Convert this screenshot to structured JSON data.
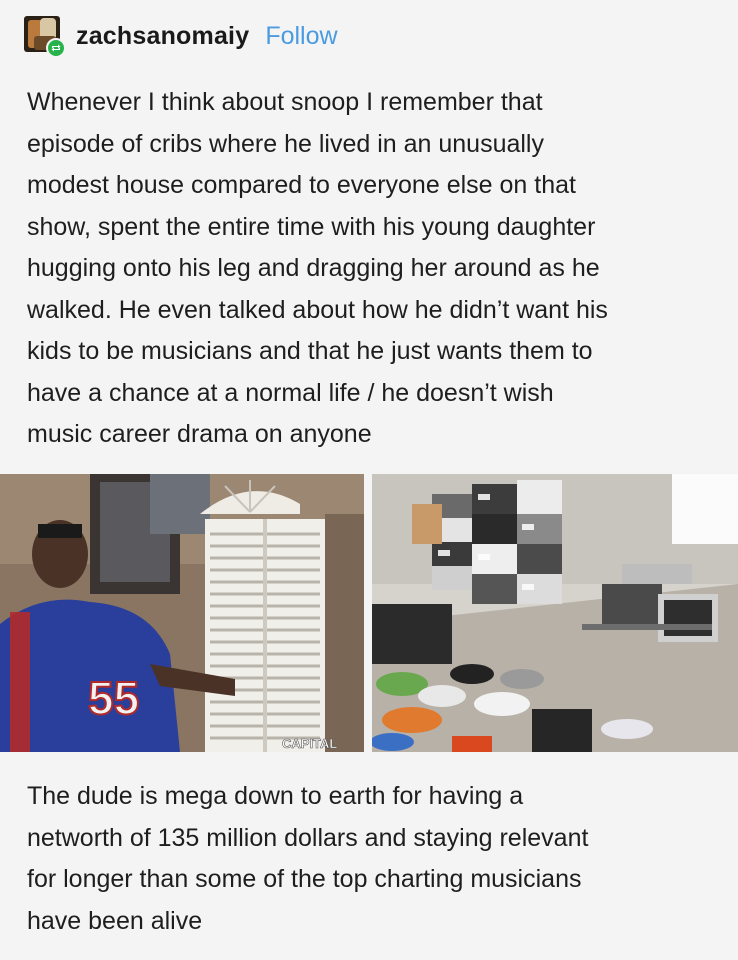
{
  "post": {
    "username": "zachsanomaiy",
    "follow_label": "Follow",
    "avatar_icon": "user-avatar",
    "reblog_icon": "reblog-icon",
    "follow_color": "#4a9be0",
    "reblog_color": "#27b34b",
    "paragraph1_lines": [
      "Whenever I think about snoop I remember that",
      "episode of cribs where he lived in an unusually",
      "modest house compared to everyone else on that",
      "show, spent the entire time with his young daughter",
      "hugging onto his leg and dragging her around as he",
      "walked. He even talked about how he didn’t want his",
      "kids to be musicians and that he just wants them to",
      "have a chance at a normal life / he doesn’t wish",
      "music career drama on anyone"
    ],
    "images": {
      "left_watermark": "CAPITAL",
      "left_jersey_number": "55"
    },
    "paragraph2_lines": [
      "The dude is mega down to earth for having a",
      "networth of 135 million dollars and staying relevant",
      "for longer than some of the top charting musicians",
      "have been alive"
    ]
  }
}
